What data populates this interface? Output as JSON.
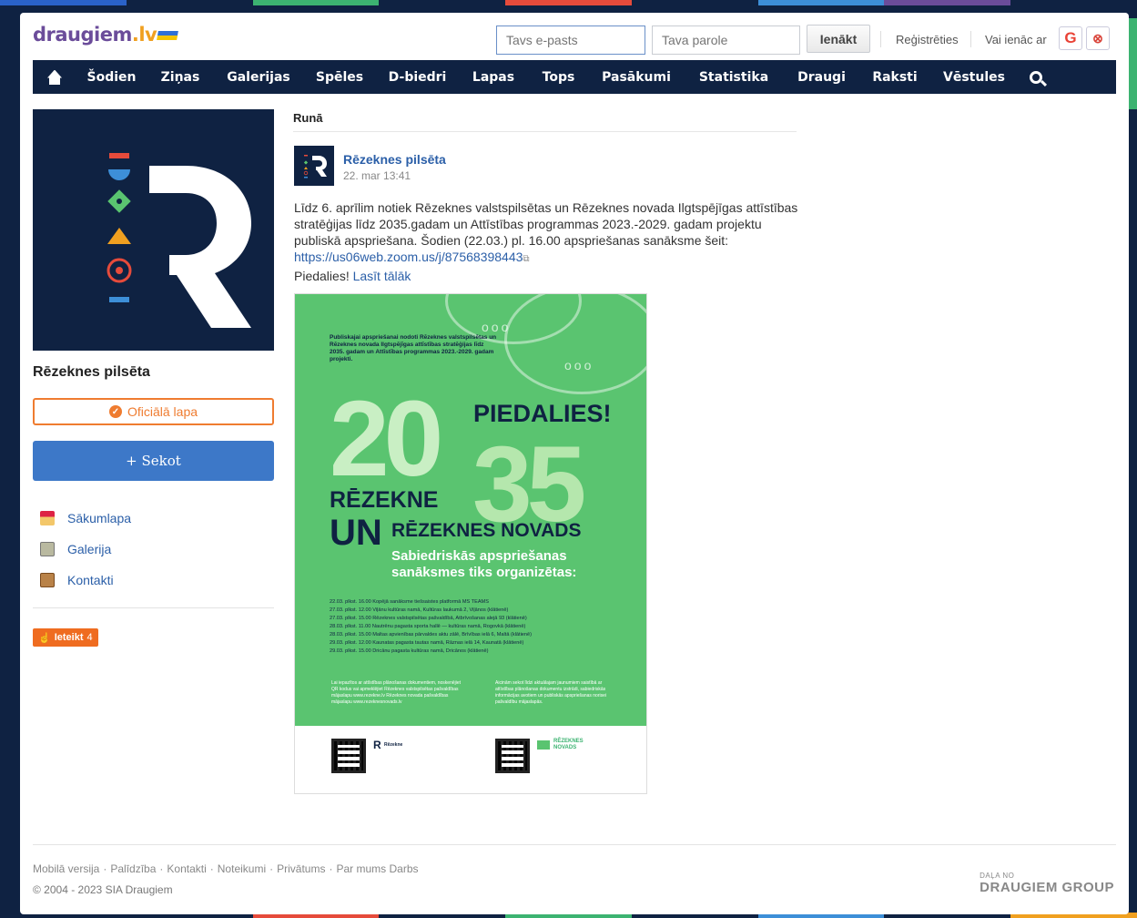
{
  "header": {
    "logo_text": "draugiem",
    "logo_tld": ".lv",
    "email_placeholder": "Tavs e-pasts",
    "password_placeholder": "Tava parole",
    "login_button": "Ienākt",
    "register_link": "Reģistrēties",
    "social_login_label": "Vai ienāc ar",
    "social_google_icon": "G",
    "social_other_icon": "⊗"
  },
  "nav": {
    "items": [
      "Šodien",
      "Ziņas",
      "Galerijas",
      "Spēles",
      "D-biedri",
      "Lapas",
      "Tops",
      "Pasākumi",
      "Statistika",
      "Draugi",
      "Raksti",
      "Vēstules"
    ]
  },
  "profile": {
    "name": "Rēzeknes pilsēta",
    "official_label": "Oficiālā lapa",
    "follow_button": "+ Sekot",
    "links": [
      "Sākumlapa",
      "Galerija",
      "Kontakti"
    ],
    "like_label": "Ieteikt",
    "like_count": "4"
  },
  "feed": {
    "section_title": "Runā",
    "post": {
      "author": "Rēzeknes pilsēta",
      "date": "22. mar 13:41",
      "text": "Līdz 6. aprīlim notiek Rēzeknes valstspilsētas un Rēzeknes novada Ilgtspējīgas attīstības stratēģijas līdz 2035.gadam un Attīstības programmas 2023.-2029. gadam projektu publiskā apspriešana. Šodien (22.03.) pl. 16.00 apspriešanas sanāksme šeit:",
      "link": "https://us06web.zoom.us/j/87568398443",
      "cta": "Piedalies!",
      "read_more": "Lasīt tālāk"
    },
    "poster": {
      "intro": "Publiskajai apspriešanai nodoti Rēzeknes valstspilsētas un Rēzeknes novada Ilgtspējīgas attīstības stratēģijas līdz 2035. gadam un Attīstības programmas 2023.-2029. gadam projekti.",
      "year_top": "20",
      "year_bottom": "35",
      "piedalies": "PIEDALIES!",
      "rezekne": "RĒZEKNE",
      "un": "UN",
      "novads": "RĒZEKNES NOVADS",
      "subtitle_1": "Sabiedriskās apspriešanas",
      "subtitle_2": "sanāksmes tiks organizētas:",
      "schedule": [
        "22.03. plkst. 16.00  Kopējā sanāksme tiešsaistes platformā MS TEAMS",
        "27.03. plkst. 12.00  Viļānu kultūras namā, Kultūras laukumā 2, Viļānos (klātienē)",
        "27.03. plkst. 15.00  Rēzeknes valstspilsētas pašvaldībā, Atbrīvošanas alejā 93 (klātienē)",
        "28.03. plkst. 11.00  Nautrēnu pagasta sporta hallē — kultūras namā, Rogovkā (klātienē)",
        "28.03. plkst. 15.00  Maltas apvienības pārvaldes aktu zālē, Brīvības ielā 6, Maltā (klātienē)",
        "29.03. plkst. 12.00  Kaunatas pagasta tautas namā, Rāznas ielā 14, Kaunatā (klātienē)",
        "29.03. plkst. 15.00  Dricānu pagasta kultūras namā, Dricānos (klātienē)"
      ],
      "left_note": "Lai iepazītos ar attīstības plānošanas dokumentiem, noskenējiet QR kodus vai apmeklējiet Rēzeknes valstspilsētas pašvaldības mājaslapu www.rezekne.lv Rēzeknes novada pašvaldības mājaslapu www.rezeknesnovads.lv",
      "right_note": "Aicinām sekot līdzi aktuālajam jaunumiem saistībā ar attīstības plānošanas dokumentu izstrādi, sabiedriskās informācijas avotiem un publiskās apspriešanas norisei pašvaldību mājaslapās.",
      "logo_left": "Rēzekne",
      "logo_right_1": "RĒZEKNES",
      "logo_right_2": "NOVADS"
    }
  },
  "footer": {
    "links": [
      "Mobilā versija",
      "Palīdzība",
      "Kontakti",
      "Noteikumi",
      "Privātums",
      "Par mums",
      "Darbs"
    ],
    "copyright": "© 2004 - 2023 SIA Draugiem",
    "group_small": "DAĻA NO",
    "group_big": "DRAUGIEM GROUP"
  },
  "colors": {
    "navy": "#0f2242",
    "accent_blue": "#3d78c8",
    "link_blue": "#2b5fa8",
    "orange": "#ef7c30",
    "poster_green": "#5ac470"
  }
}
